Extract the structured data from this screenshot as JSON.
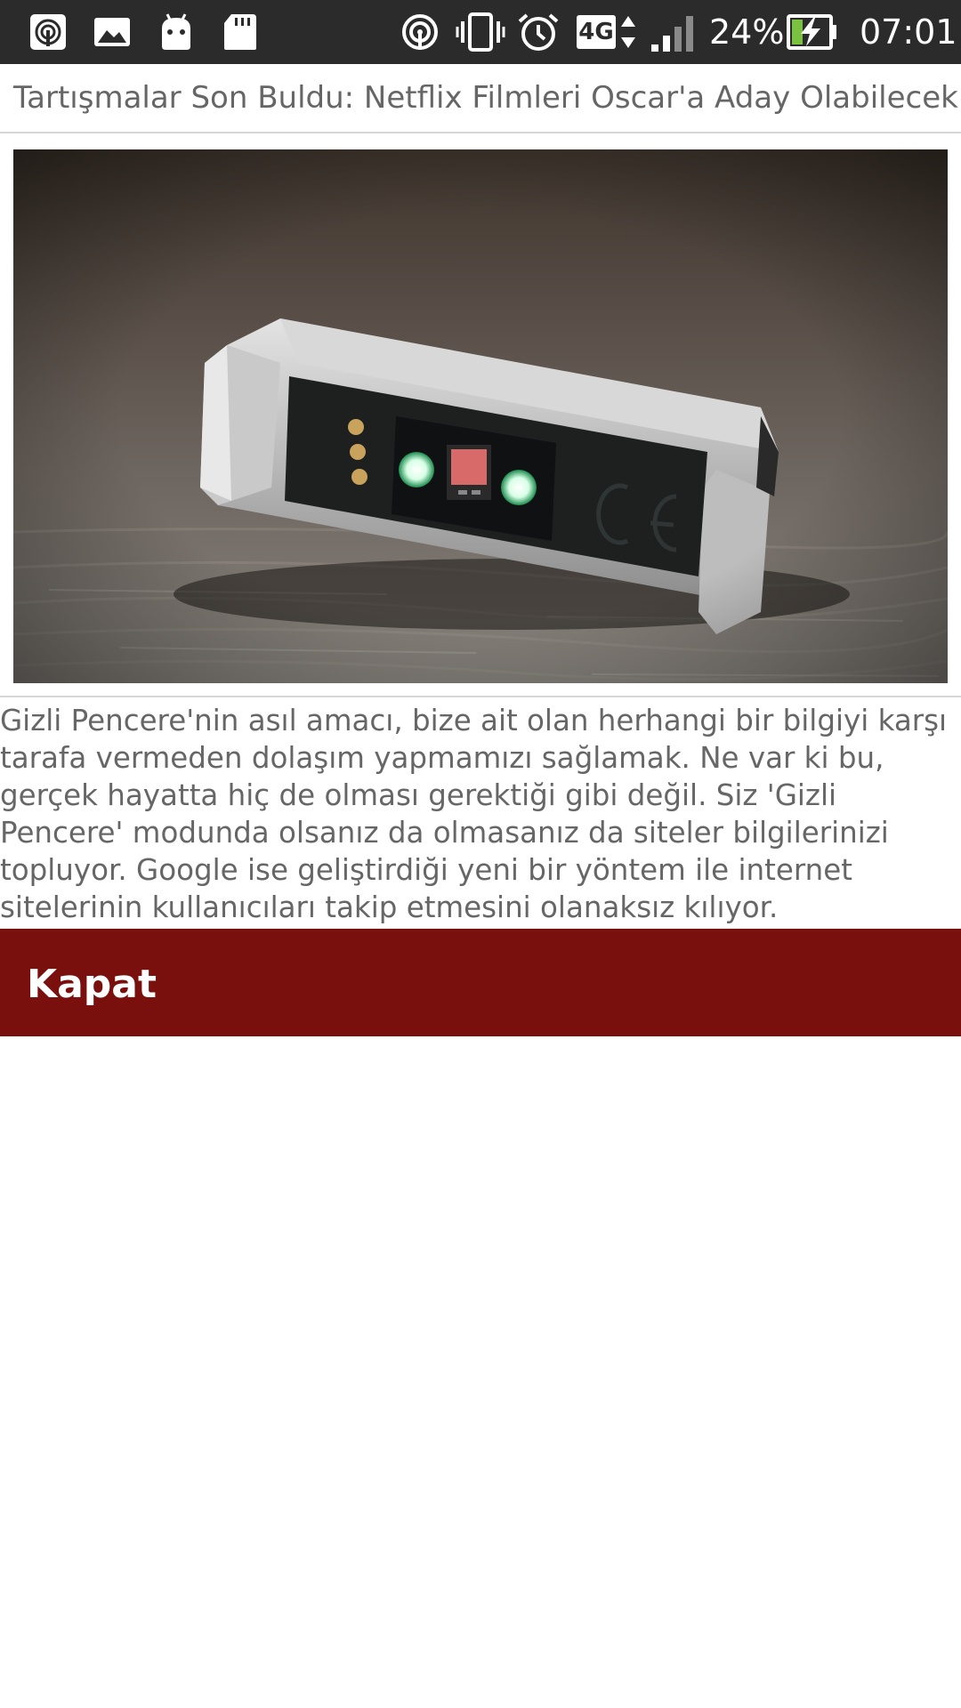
{
  "status_bar": {
    "battery_percent": "24%",
    "time": "07:01",
    "network_type": "4G",
    "icons": {
      "left": [
        "hotspot-icon",
        "gallery-icon",
        "android-icon",
        "sd-card-icon"
      ],
      "right": [
        "hotspot-icon",
        "vibrate-icon",
        "alarm-icon",
        "4g-icon",
        "signal-icon",
        "battery-charging-icon"
      ]
    },
    "colors": {
      "background": "#2b2b2b",
      "battery_fill": "#7ac142"
    }
  },
  "article": {
    "headline": "Tartışmalar Son Buldu: Netflix Filmleri Oscar'a Aday Olabilecek",
    "body": "Gizli Pencere'nin asıl amacı, bize ait olan herhangi bir bilgiyi karşı tarafa vermeden dolaşım yapmamızı sağlamak. Ne var ki bu, gerçek hayatta hiç de olması gerektiği gibi değil. Siz 'Gizli Pencere' modunda olsanız da olmasanız da siteler bilgilerinizi topluyor. Google ise geliştirdiği yeni bir yöntem ile internet sitelerinin kullanıcıları takip etmesini olanaksız kılıyor."
  },
  "close_button": {
    "label": "Kapat",
    "color": "#7a100e"
  }
}
